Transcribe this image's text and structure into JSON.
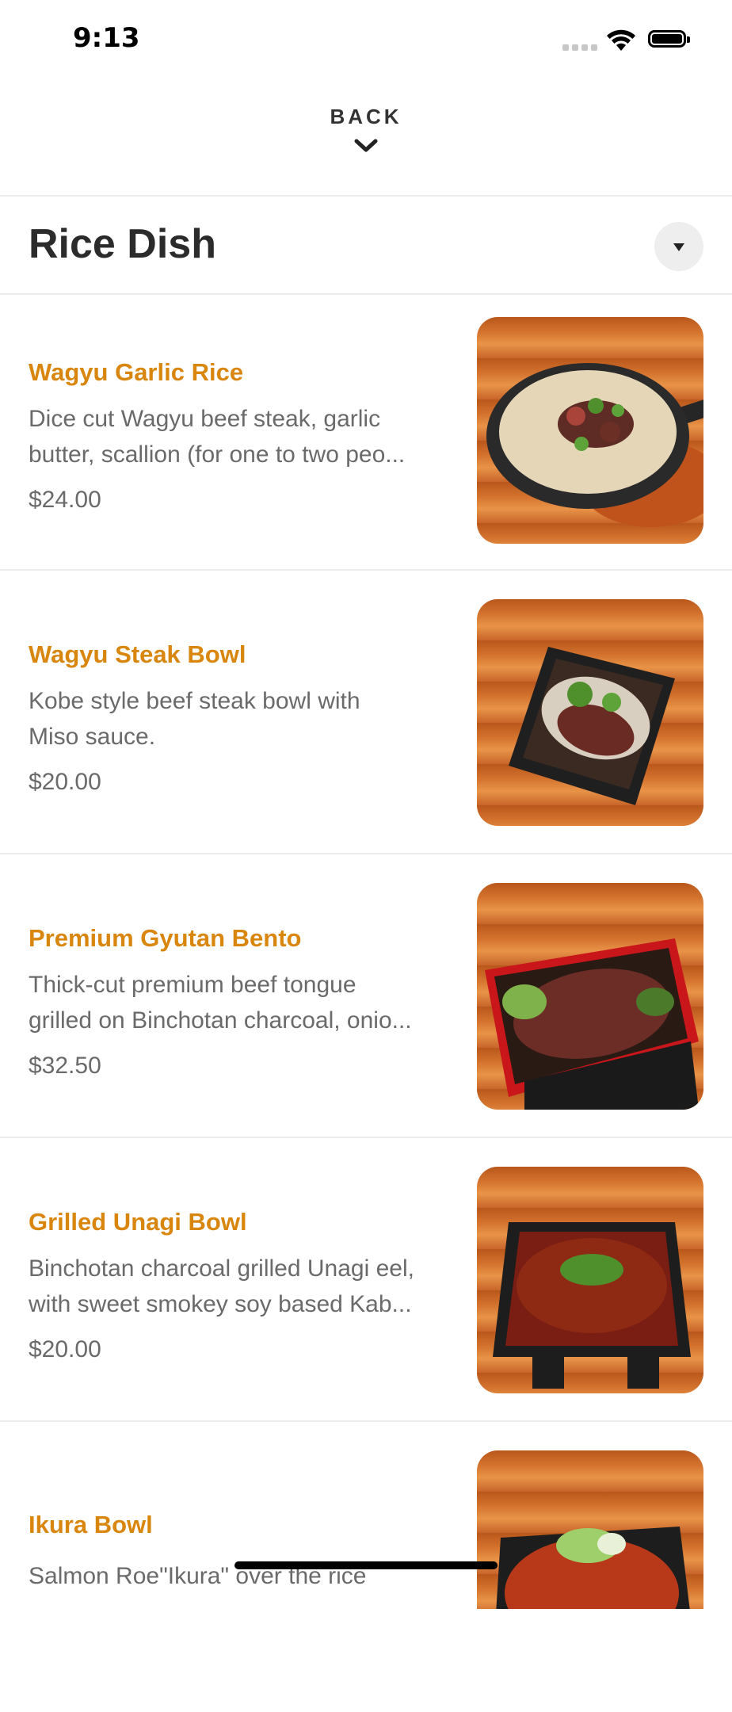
{
  "status_bar": {
    "time": "9:13"
  },
  "nav": {
    "back_label": "BACK"
  },
  "section": {
    "title": "Rice Dish"
  },
  "menu_items": [
    {
      "name": "Wagyu Garlic Rice",
      "description_lines": [
        "Dice cut Wagyu beef steak, garlic",
        "butter, scallion (for one to two peo..."
      ],
      "price": "$24.00"
    },
    {
      "name": "Wagyu Steak Bowl",
      "description_lines": [
        "Kobe style beef steak bowl with",
        "Miso sauce."
      ],
      "price": "$20.00"
    },
    {
      "name": "Premium Gyutan Bento",
      "description_lines": [
        "Thick-cut premium beef tongue",
        "grilled on Binchotan charcoal, onio..."
      ],
      "price": "$32.50"
    },
    {
      "name": "Grilled Unagi Bowl",
      "description_lines": [
        "Binchotan charcoal grilled Unagi eel,",
        "with sweet smokey soy based Kab..."
      ],
      "price": "$20.00"
    },
    {
      "name": "Ikura Bowl",
      "description_lines": [
        "Salmon Roe\"Ikura\" over the rice"
      ],
      "price": ""
    }
  ],
  "colors": {
    "item_name": "#d9860e",
    "text_secondary": "#6a6a6a",
    "title": "#2b2b2b"
  }
}
